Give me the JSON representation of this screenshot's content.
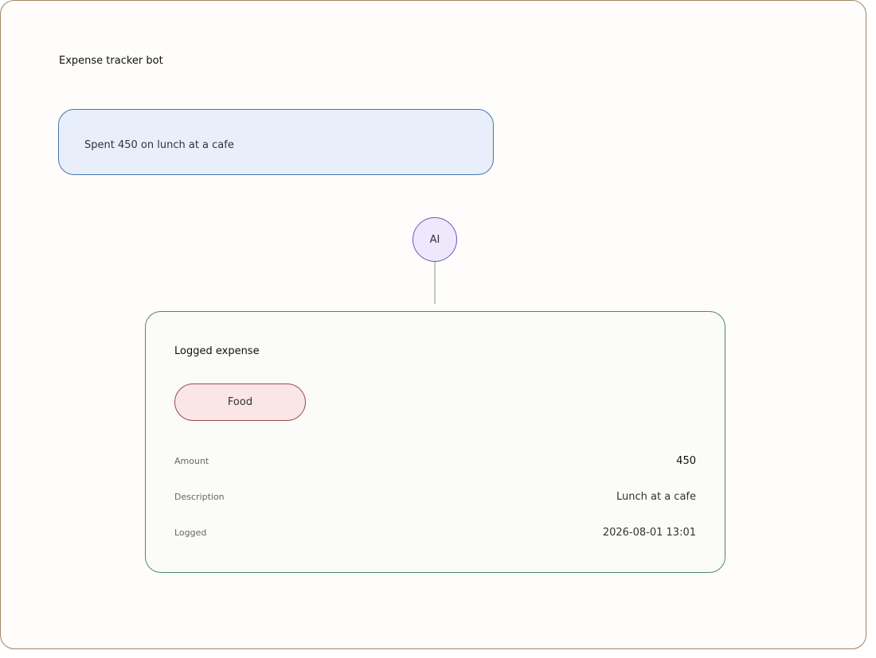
{
  "header": {
    "title": "Expense tracker bot"
  },
  "user_message": {
    "text": "Spent 450 on lunch at a cafe"
  },
  "assistant": {
    "avatar_label": "AI"
  },
  "expense_card": {
    "title": "Logged expense",
    "category": "Food",
    "fields": [
      {
        "label": "Amount",
        "value": "450"
      },
      {
        "label": "Description",
        "value": "Lunch at a cafe"
      },
      {
        "label": "Logged",
        "value": "2026-08-01 13:01"
      }
    ]
  },
  "colors": {
    "frame_border": "#a08464",
    "user_bubble_bg": "#e8effb",
    "user_bubble_border": "#4a72b0",
    "ai_node_bg": "#ede8fb",
    "ai_node_border": "#6a58c0",
    "card_border": "#4c8a6c",
    "category_bg": "#fae6e6",
    "category_border": "#9a4a4a"
  }
}
